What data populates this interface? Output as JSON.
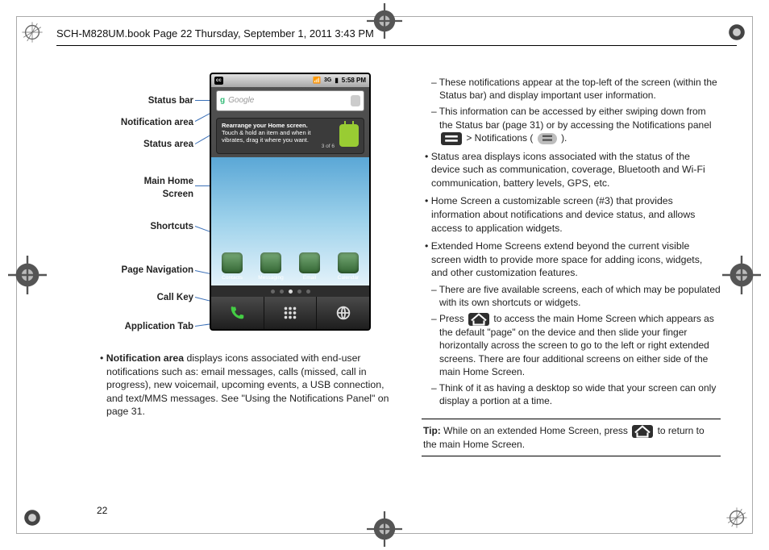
{
  "header": "SCH-M828UM.book  Page 22  Thursday, September 1, 2011  3:43 PM",
  "page_number": "22",
  "labels": {
    "status_bar": "Status bar",
    "notification_area": "Notification area",
    "status_area": "Status area",
    "main_home": "Main Home\nScreen",
    "shortcuts": "Shortcuts",
    "page_nav": "Page Navigation",
    "call_key": "Call Key",
    "app_tab": "Application Tab"
  },
  "phone": {
    "time": "5:58 PM",
    "search_placeholder": "Google",
    "tip_title": "Rearrange your Home screen.",
    "tip_body": "Touch & hold an item and when it vibrates, drag it where you want.",
    "tip_count": "3 of 6",
    "apps": [
      "Contacts",
      "Messaging",
      "Email",
      "Calendar"
    ]
  },
  "left_bullet": {
    "title": "Notification area",
    "text": " displays icons associated with end-user notifications such as: email messages, calls (missed, call in progress), new voicemail, upcoming events, a USB connection, and text/MMS messages. See \"Using the Notifications Panel\" on page 31."
  },
  "right": {
    "s1": "These notifications appear at the top-left of the screen (within the Status bar) and display important user information.",
    "s2a": "This information can be accessed by either swiping down from the Status bar (page 31) or by accessing the Notifications panel ",
    "s2b": " > Notifications ( ",
    "s2c": " ).",
    "b2": "Status area displays icons associated with the status of the device such as communication, coverage, Bluetooth and Wi-Fi communication, battery levels, GPS, etc.",
    "b3": "Home Screen a customizable screen (#3) that provides information about notifications and device status, and allows access to application widgets.",
    "b4": "Extended Home Screens extend beyond the current visible screen width to provide more space for adding icons, widgets, and other customization features.",
    "s3": "There are five available screens, each of which may be populated with its own shortcuts or widgets.",
    "s4a": "Press ",
    "s4b": " to access the main Home Screen which appears as the default \"page\" on the device and then slide your finger horizontally across the screen to go to the left or right extended screens. There are four additional screens on either side of the main Home Screen.",
    "s5": "Think of it as having a desktop so wide that your screen can only display a portion at a time."
  },
  "tip": {
    "label": "Tip:",
    "a": " While on an extended Home Screen, press ",
    "b": " to return to the main Home Screen."
  }
}
